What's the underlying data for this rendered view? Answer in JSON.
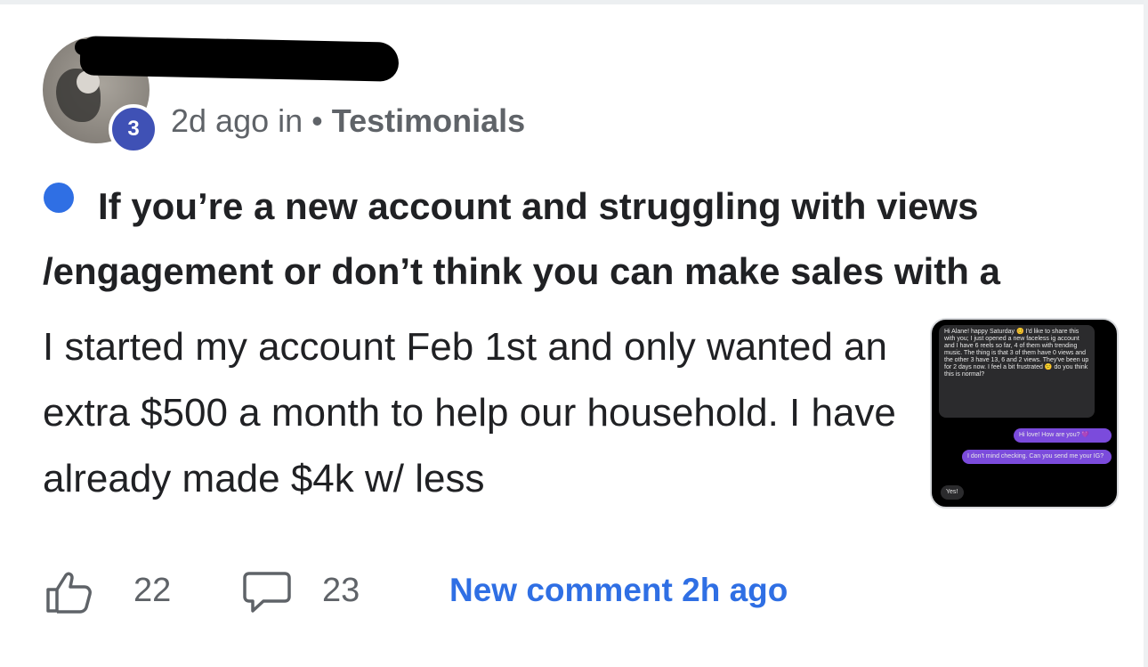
{
  "post": {
    "level": "3",
    "time_ago": "2d ago in",
    "separator": "•",
    "category": "Testimonials",
    "title": "If you’re a new account and struggling with views /engagement or don’t think you can make sales with a",
    "body": "I started my account Feb 1st and only wanted an extra $500 a month to help our household. I have already made $4k w/ less",
    "thumbnail_messages": [
      "Hi Alane! happy Saturday 😊 I'd like to share this with you; I just opened a new faceless ig account and I have 6 reels so far, 4 of them with trending music. The thing is that 3 of them have 0 views and the other 3 have 13, 6 and 2 views. They've been up for 2 days now. I feel a bit frustrated 😕 do you think this is normal?",
      "Hi love! How are you? 💜",
      "I don't mind checking. Can you send me your IG?",
      "Yes!"
    ]
  },
  "footer": {
    "likes": "22",
    "comments": "23",
    "new_comment": "New comment 2h ago"
  },
  "colors": {
    "accent": "#2f6fe4",
    "badge": "#3f51b5",
    "meta_text": "#5f6368"
  }
}
